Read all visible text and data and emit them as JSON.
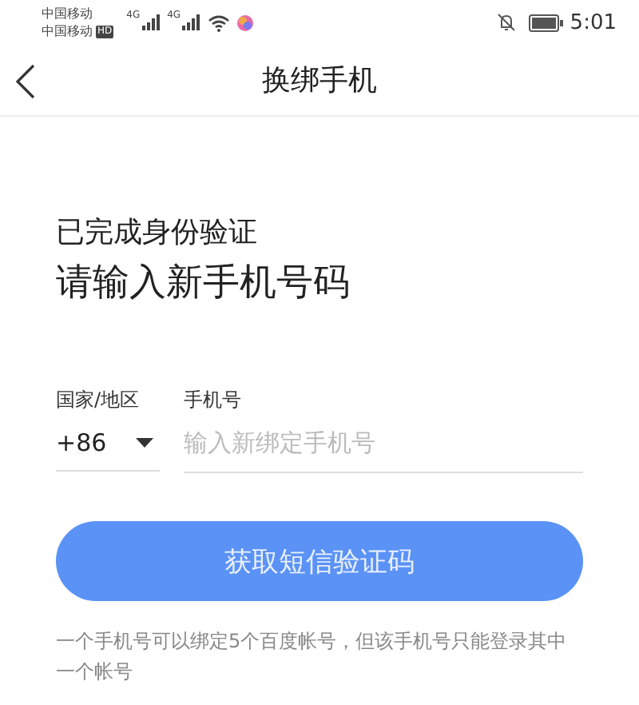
{
  "status_bar": {
    "carriers": [
      "中国移动",
      "中国移动"
    ],
    "hd": "HD",
    "networks": [
      "4G",
      "4G"
    ],
    "time": "5:01"
  },
  "nav": {
    "title": "换绑手机"
  },
  "heading": {
    "subtitle": "已完成身份验证",
    "title": "请输入新手机号码"
  },
  "form": {
    "region_label": "国家/地区",
    "region_value": "+86",
    "phone_label": "手机号",
    "phone_placeholder": "输入新绑定手机号"
  },
  "submit": {
    "label": "获取短信验证码",
    "disabled": true
  },
  "note": "一个手机号可以绑定5个百度帐号，但该手机号只能登录其中一个帐号"
}
